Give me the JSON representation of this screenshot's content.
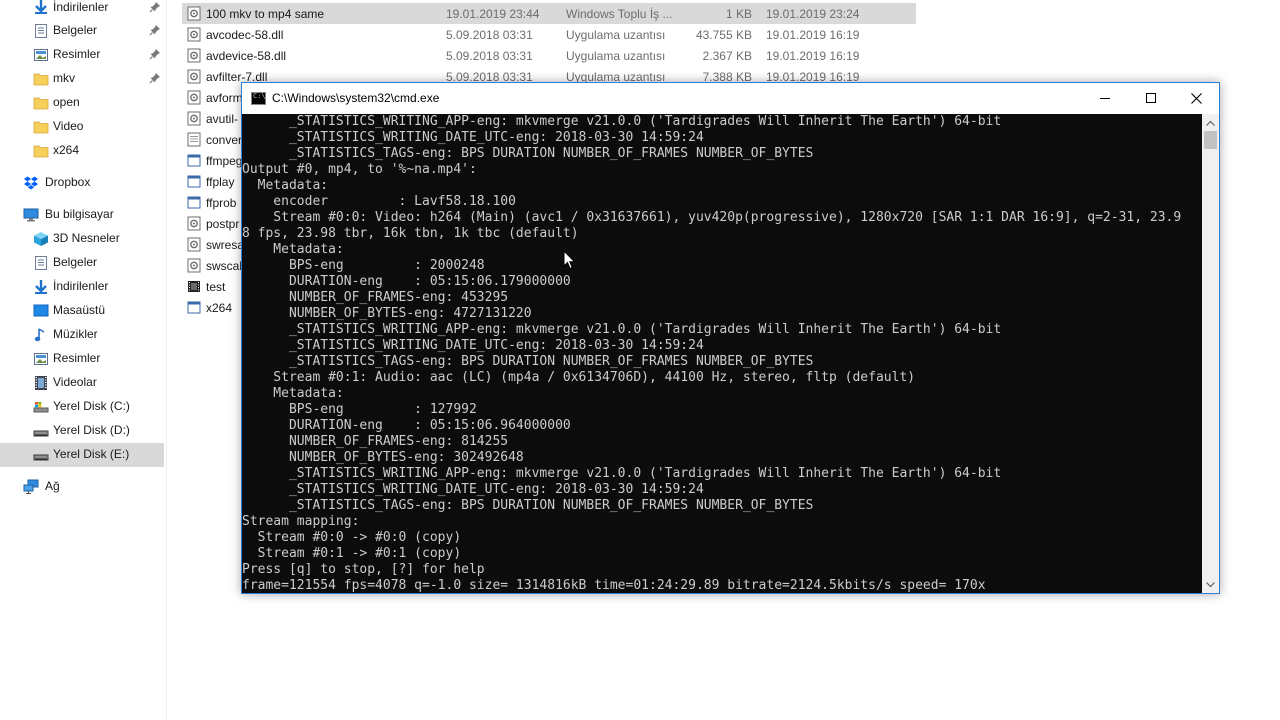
{
  "sidebar": {
    "items": [
      {
        "label": "İndirilenler",
        "icon": "download-arrow-icon",
        "pinned": true
      },
      {
        "label": "Belgeler",
        "icon": "documents-icon",
        "pinned": true
      },
      {
        "label": "Resimler",
        "icon": "pictures-icon",
        "pinned": true
      },
      {
        "label": "mkv",
        "icon": "folder-icon",
        "pinned": true
      },
      {
        "label": "open",
        "icon": "folder-icon",
        "pinned": false
      },
      {
        "label": "Video",
        "icon": "folder-icon",
        "pinned": false
      },
      {
        "label": "x264",
        "icon": "folder-icon",
        "pinned": false
      },
      {
        "label": "Dropbox",
        "icon": "dropbox-icon",
        "pinned": false
      },
      {
        "label": "Bu bilgisayar",
        "icon": "computer-icon",
        "pinned": false
      },
      {
        "label": "3D Nesneler",
        "icon": "3d-objects-icon",
        "pinned": false
      },
      {
        "label": "Belgeler",
        "icon": "documents-icon",
        "pinned": false
      },
      {
        "label": "İndirilenler",
        "icon": "download-arrow-icon",
        "pinned": false
      },
      {
        "label": "Masaüstü",
        "icon": "desktop-icon",
        "pinned": false
      },
      {
        "label": "Müzikler",
        "icon": "music-icon",
        "pinned": false
      },
      {
        "label": "Resimler",
        "icon": "pictures-icon",
        "pinned": false
      },
      {
        "label": "Videolar",
        "icon": "videos-icon",
        "pinned": false
      },
      {
        "label": "Yerel Disk (C:)",
        "icon": "drive-icon",
        "pinned": false
      },
      {
        "label": "Yerel Disk (D:)",
        "icon": "drive-icon",
        "pinned": false
      },
      {
        "label": "Yerel Disk (E:)",
        "icon": "drive-icon",
        "pinned": false,
        "selected": true
      },
      {
        "label": "Ağ",
        "icon": "network-icon",
        "pinned": false
      }
    ]
  },
  "files": [
    {
      "name": "100 mkv to mp4 same",
      "date": "19.01.2019 23:44",
      "type": "Windows Toplu İş ...",
      "size": "1 KB",
      "date2": "19.01.2019 23:24",
      "icon": "batch-file-icon",
      "selected": true
    },
    {
      "name": "avcodec-58.dll",
      "date": "5.09.2018 03:31",
      "type": "Uygulama uzantısı",
      "size": "43.755 KB",
      "date2": "19.01.2019 16:19",
      "icon": "dll-file-icon"
    },
    {
      "name": "avdevice-58.dll",
      "date": "5.09.2018 03:31",
      "type": "Uygulama uzantısı",
      "size": "2.367 KB",
      "date2": "19.01.2019 16:19",
      "icon": "dll-file-icon"
    },
    {
      "name": "avfilter-7.dll",
      "date": "5.09.2018 03:31",
      "type": "Uygulama uzantısı",
      "size": "7.388 KB",
      "date2": "19.01.2019 16:19",
      "icon": "dll-file-icon"
    },
    {
      "name": "avform",
      "icon": "dll-file-icon"
    },
    {
      "name": "avutil-",
      "icon": "dll-file-icon"
    },
    {
      "name": "conver",
      "icon": "text-file-icon"
    },
    {
      "name": "ffmpeg",
      "icon": "exe-file-icon"
    },
    {
      "name": "ffplay",
      "icon": "exe-file-icon"
    },
    {
      "name": "ffprob",
      "icon": "exe-file-icon"
    },
    {
      "name": "postpr",
      "icon": "dll-file-icon"
    },
    {
      "name": "swresa",
      "icon": "dll-file-icon"
    },
    {
      "name": "swscal",
      "icon": "dll-file-icon"
    },
    {
      "name": "test",
      "icon": "video-file-icon"
    },
    {
      "name": "x264",
      "icon": "exe-file-icon"
    }
  ],
  "cmd": {
    "title": "C:\\Windows\\system32\\cmd.exe",
    "lines": [
      "      _STATISTICS_WRITING_APP-eng: mkvmerge v21.0.0 ('Tardigrades Will Inherit The Earth') 64-bit",
      "      _STATISTICS_WRITING_DATE_UTC-eng: 2018-03-30 14:59:24",
      "      _STATISTICS_TAGS-eng: BPS DURATION NUMBER_OF_FRAMES NUMBER_OF_BYTES",
      "Output #0, mp4, to '%~na.mp4':",
      "  Metadata:",
      "    encoder         : Lavf58.18.100",
      "    Stream #0:0: Video: h264 (Main) (avc1 / 0x31637661), yuv420p(progressive), 1280x720 [SAR 1:1 DAR 16:9], q=2-31, 23.9",
      "8 fps, 23.98 tbr, 16k tbn, 1k tbc (default)",
      "    Metadata:",
      "      BPS-eng         : 2000248",
      "      DURATION-eng    : 05:15:06.179000000",
      "      NUMBER_OF_FRAMES-eng: 453295",
      "      NUMBER_OF_BYTES-eng: 4727131220",
      "      _STATISTICS_WRITING_APP-eng: mkvmerge v21.0.0 ('Tardigrades Will Inherit The Earth') 64-bit",
      "      _STATISTICS_WRITING_DATE_UTC-eng: 2018-03-30 14:59:24",
      "      _STATISTICS_TAGS-eng: BPS DURATION NUMBER_OF_FRAMES NUMBER_OF_BYTES",
      "    Stream #0:1: Audio: aac (LC) (mp4a / 0x6134706D), 44100 Hz, stereo, fltp (default)",
      "    Metadata:",
      "      BPS-eng         : 127992",
      "      DURATION-eng    : 05:15:06.964000000",
      "      NUMBER_OF_FRAMES-eng: 814255",
      "      NUMBER_OF_BYTES-eng: 302492648",
      "      _STATISTICS_WRITING_APP-eng: mkvmerge v21.0.0 ('Tardigrades Will Inherit The Earth') 64-bit",
      "      _STATISTICS_WRITING_DATE_UTC-eng: 2018-03-30 14:59:24",
      "      _STATISTICS_TAGS-eng: BPS DURATION NUMBER_OF_FRAMES NUMBER_OF_BYTES",
      "Stream mapping:",
      "  Stream #0:0 -> #0:0 (copy)",
      "  Stream #0:1 -> #0:1 (copy)",
      "Press [q] to stop, [?] for help",
      "frame=121554 fps=4078 q=-1.0 size= 1314816kB time=01:24:29.89 bitrate=2124.5kbits/s speed= 170x"
    ]
  },
  "colors": {
    "console_bg": "#0c0c0c",
    "console_fg": "#cccccc",
    "selection": "#d9d9d9",
    "accent_border": "#2a7fd4",
    "folder": "#f5cf5c",
    "dropbox": "#0061fe"
  }
}
